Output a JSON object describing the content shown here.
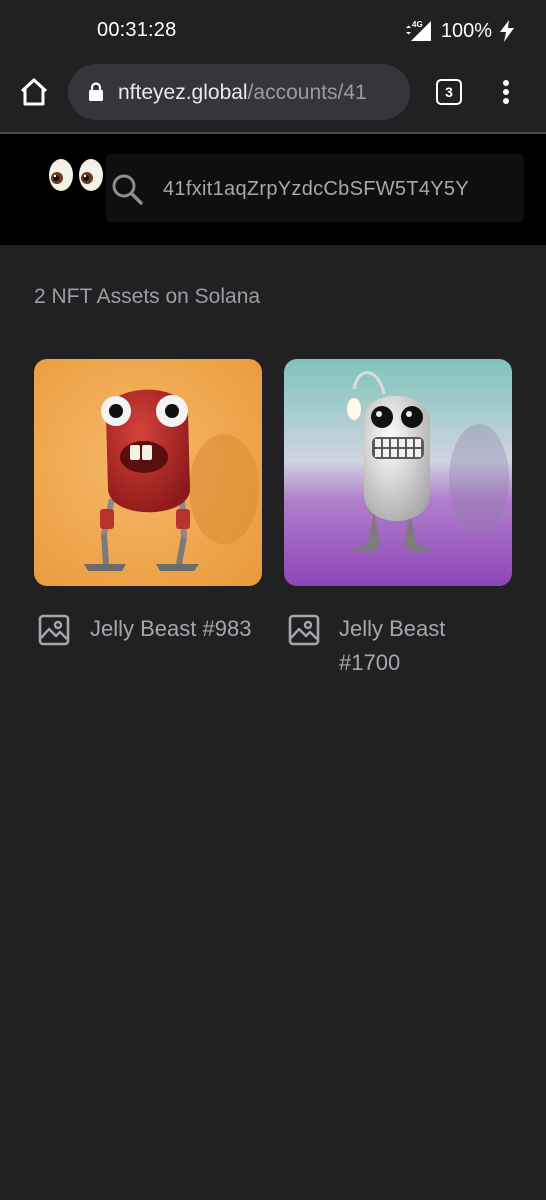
{
  "status_bar": {
    "time": "00:31:28",
    "network": "4G",
    "battery": "100%"
  },
  "browser": {
    "url_domain": "nfteyez.global",
    "url_path": "/accounts/41",
    "tab_count": "3"
  },
  "site": {
    "search_value": "41fxit1aqZrpYzdcCbSFW5T4Y5Y"
  },
  "content": {
    "assets_count": "2 NFT Assets on Solana",
    "nfts": [
      {
        "name": "Jelly Beast #983"
      },
      {
        "name": "Jelly Beast #1700"
      }
    ]
  },
  "colors": {
    "background": "#212023",
    "header_bg": "#000000",
    "url_bar": "#36353a",
    "card1_bg": "#f0a94e",
    "card2_bg_top": "#7ec4ba",
    "card2_bg_bottom": "#9b4fbf"
  },
  "icons": {
    "home": "home-icon",
    "lock": "lock-icon",
    "menu": "more-vert-icon",
    "search": "search-icon",
    "image": "image-icon",
    "logo": "eyes-logo"
  }
}
